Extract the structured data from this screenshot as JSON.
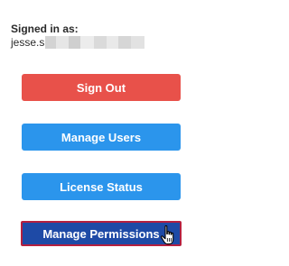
{
  "account": {
    "signed_in_label": "Signed in as:",
    "username_visible": "jesse.s",
    "redaction_colors": [
      "#d3d3d3",
      "#e6e6e6",
      "#cfcfcf",
      "#ececec",
      "#dadada",
      "#e9e9e9",
      "#d6d6d6",
      "#e2e2e2"
    ]
  },
  "buttons": {
    "sign_out": "Sign Out",
    "manage_users": "Manage Users",
    "license_status": "License Status",
    "manage_permissions": "Manage Permissions"
  },
  "colors": {
    "sign_out_bg": "#e8514a",
    "primary_bg": "#2b95ec",
    "active_bg": "#1e4aa6",
    "active_border": "#b5203f"
  },
  "cursor": {
    "icon": "hand-pointer-icon"
  }
}
